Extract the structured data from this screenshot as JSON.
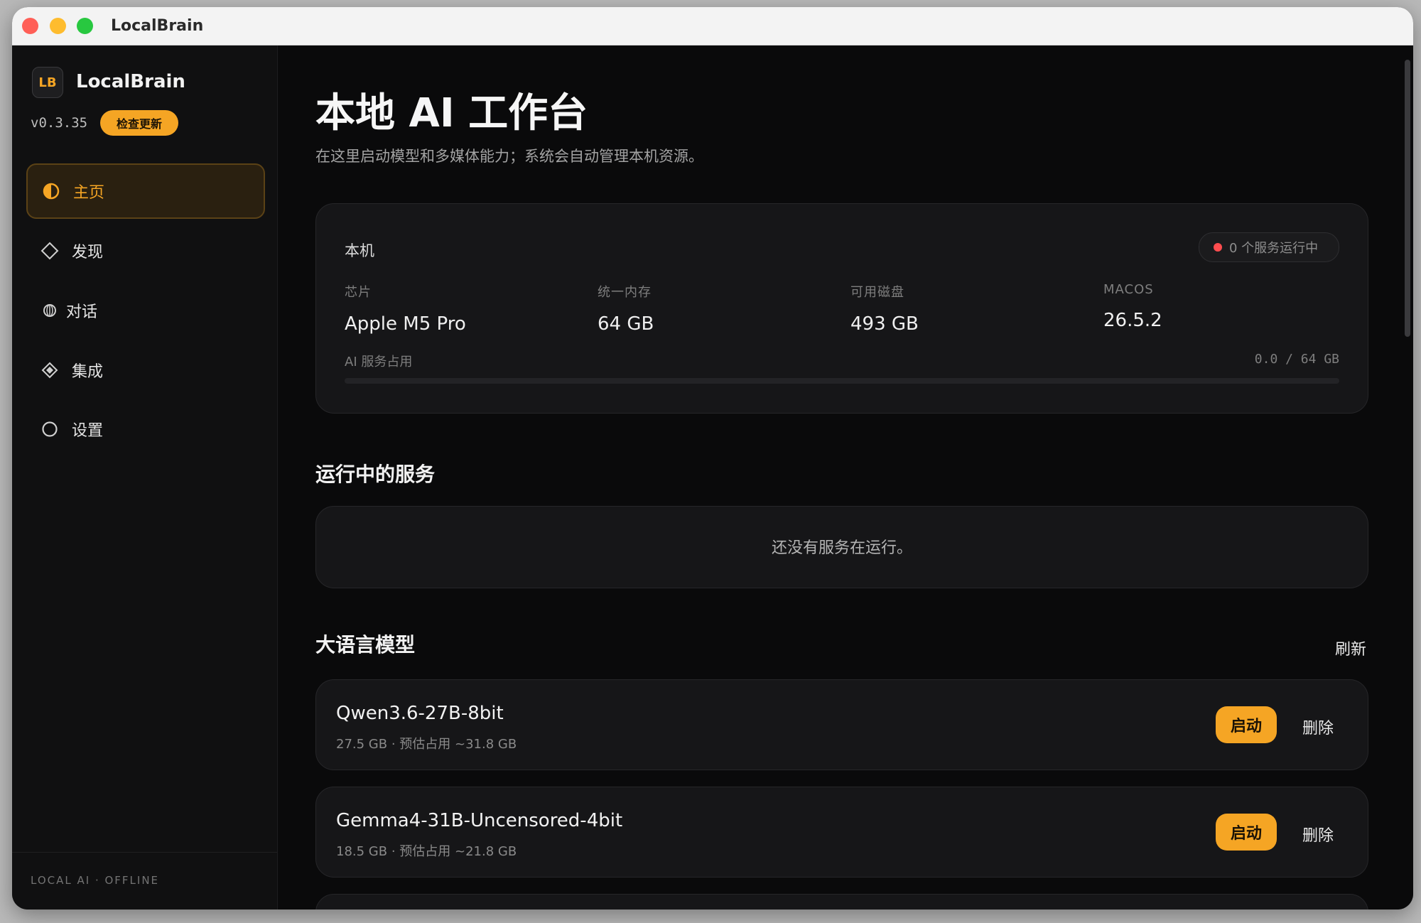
{
  "window": {
    "title": "LocalBrain"
  },
  "sidebar": {
    "logo_text": "LB",
    "app_name": "LocalBrain",
    "version": "v0.3.35",
    "update_label": "检查更新",
    "items": [
      {
        "label": "主页",
        "icon": "half-circle-icon",
        "active": true
      },
      {
        "label": "发现",
        "icon": "diamond-outline-icon",
        "active": false
      },
      {
        "label": "对话",
        "icon": "globe-icon",
        "active": false
      },
      {
        "label": "集成",
        "icon": "diamond-filled-icon",
        "active": false
      },
      {
        "label": "设置",
        "icon": "circle-outline-icon",
        "active": false
      }
    ],
    "footer": "LOCAL AI · OFFLINE"
  },
  "main": {
    "title": "本地 AI 工作台",
    "subtitle": "在这里启动模型和多媒体能力；系统会自动管理本机资源。",
    "host": {
      "label": "本机",
      "status": "0 个服务运行中",
      "status_color": "#ff4d4f",
      "specs": [
        {
          "label": "芯片",
          "value": "Apple M5 Pro"
        },
        {
          "label": "统一内存",
          "value": "64 GB"
        },
        {
          "label": "可用磁盘",
          "value": "493 GB"
        },
        {
          "label": "MACOS",
          "value": "26.5.2"
        }
      ],
      "usage_label": "AI 服务占用",
      "usage_value": "0.0 / 64 GB",
      "usage_fraction": 0
    },
    "running": {
      "title": "运行中的服务",
      "empty_text": "还没有服务在运行。"
    },
    "llm": {
      "title": "大语言模型",
      "refresh_label": "刷新",
      "start_label": "启动",
      "delete_label": "删除",
      "models": [
        {
          "name": "Qwen3.6-27B-8bit",
          "meta": "27.5 GB · 预估占用 ~31.8 GB"
        },
        {
          "name": "Gemma4-31B-Uncensored-4bit",
          "meta": "18.5 GB · 预估占用 ~21.8 GB"
        }
      ]
    }
  },
  "colors": {
    "accent": "#f5a524",
    "background": "#0a0a0b",
    "card": "#161618"
  }
}
